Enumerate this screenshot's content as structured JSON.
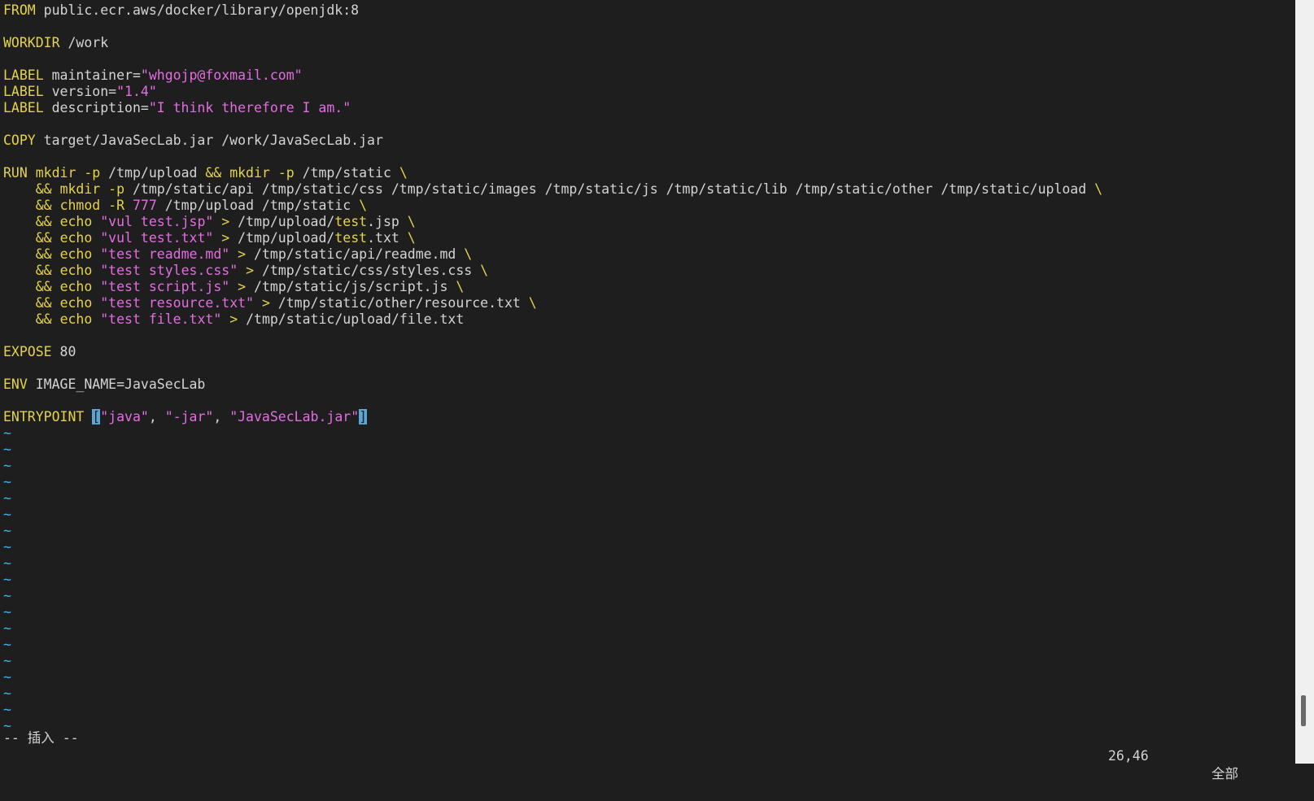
{
  "editor": {
    "lines": [
      [
        {
          "c": "kw",
          "t": "FROM"
        },
        {
          "c": "txt",
          "t": " public.ecr.aws/docker/library/openjdk:8"
        }
      ],
      [],
      [
        {
          "c": "kw",
          "t": "WORKDIR"
        },
        {
          "c": "txt",
          "t": " /work"
        }
      ],
      [],
      [
        {
          "c": "kw",
          "t": "LABEL"
        },
        {
          "c": "txt",
          "t": " maintainer="
        },
        {
          "c": "str",
          "t": "\"whgojp@foxmail.com\""
        }
      ],
      [
        {
          "c": "kw",
          "t": "LABEL"
        },
        {
          "c": "txt",
          "t": " version="
        },
        {
          "c": "str",
          "t": "\"1.4\""
        }
      ],
      [
        {
          "c": "kw",
          "t": "LABEL"
        },
        {
          "c": "txt",
          "t": " description="
        },
        {
          "c": "str",
          "t": "\"I think therefore I am.\""
        }
      ],
      [],
      [
        {
          "c": "kw",
          "t": "COPY"
        },
        {
          "c": "txt",
          "t": " target/JavaSecLab.jar /work/JavaSecLab.jar"
        }
      ],
      [],
      [
        {
          "c": "kw",
          "t": "RUN"
        },
        {
          "c": "txt",
          "t": " "
        },
        {
          "c": "cmd",
          "t": "mkdir"
        },
        {
          "c": "txt",
          "t": " "
        },
        {
          "c": "opt",
          "t": "-p"
        },
        {
          "c": "txt",
          "t": " /tmp/upload "
        },
        {
          "c": "amp",
          "t": "&&"
        },
        {
          "c": "txt",
          "t": " "
        },
        {
          "c": "cmd",
          "t": "mkdir"
        },
        {
          "c": "txt",
          "t": " "
        },
        {
          "c": "opt",
          "t": "-p"
        },
        {
          "c": "txt",
          "t": " /tmp/static "
        },
        {
          "c": "bs",
          "t": "\\"
        }
      ],
      [
        {
          "c": "txt",
          "t": "    "
        },
        {
          "c": "amp",
          "t": "&&"
        },
        {
          "c": "txt",
          "t": " "
        },
        {
          "c": "cmd",
          "t": "mkdir"
        },
        {
          "c": "txt",
          "t": " "
        },
        {
          "c": "opt",
          "t": "-p"
        },
        {
          "c": "txt",
          "t": " /tmp/static/api /tmp/static/css /tmp/static/images /tmp/static/js /tmp/static/lib /tmp/static/other /tmp/static/upload "
        },
        {
          "c": "bs",
          "t": "\\"
        }
      ],
      [
        {
          "c": "txt",
          "t": "    "
        },
        {
          "c": "amp",
          "t": "&&"
        },
        {
          "c": "txt",
          "t": " "
        },
        {
          "c": "cmd",
          "t": "chmod"
        },
        {
          "c": "txt",
          "t": " "
        },
        {
          "c": "opt",
          "t": "-R"
        },
        {
          "c": "txt",
          "t": " "
        },
        {
          "c": "num",
          "t": "777"
        },
        {
          "c": "txt",
          "t": " /tmp/upload /tmp/static "
        },
        {
          "c": "bs",
          "t": "\\"
        }
      ],
      [
        {
          "c": "txt",
          "t": "    "
        },
        {
          "c": "amp",
          "t": "&&"
        },
        {
          "c": "txt",
          "t": " "
        },
        {
          "c": "cmd",
          "t": "echo"
        },
        {
          "c": "txt",
          "t": " "
        },
        {
          "c": "str",
          "t": "\"vul test.jsp\""
        },
        {
          "c": "txt",
          "t": " "
        },
        {
          "c": "amp",
          "t": ">"
        },
        {
          "c": "txt",
          "t": " /tmp/upload/"
        },
        {
          "c": "dir",
          "t": "test"
        },
        {
          "c": "txt",
          "t": ".jsp "
        },
        {
          "c": "bs",
          "t": "\\"
        }
      ],
      [
        {
          "c": "txt",
          "t": "    "
        },
        {
          "c": "amp",
          "t": "&&"
        },
        {
          "c": "txt",
          "t": " "
        },
        {
          "c": "cmd",
          "t": "echo"
        },
        {
          "c": "txt",
          "t": " "
        },
        {
          "c": "str",
          "t": "\"vul test.txt\""
        },
        {
          "c": "txt",
          "t": " "
        },
        {
          "c": "amp",
          "t": ">"
        },
        {
          "c": "txt",
          "t": " /tmp/upload/"
        },
        {
          "c": "dir",
          "t": "test"
        },
        {
          "c": "txt",
          "t": ".txt "
        },
        {
          "c": "bs",
          "t": "\\"
        }
      ],
      [
        {
          "c": "txt",
          "t": "    "
        },
        {
          "c": "amp",
          "t": "&&"
        },
        {
          "c": "txt",
          "t": " "
        },
        {
          "c": "cmd",
          "t": "echo"
        },
        {
          "c": "txt",
          "t": " "
        },
        {
          "c": "str",
          "t": "\"test readme.md\""
        },
        {
          "c": "txt",
          "t": " "
        },
        {
          "c": "amp",
          "t": ">"
        },
        {
          "c": "txt",
          "t": " /tmp/static/api/readme.md "
        },
        {
          "c": "bs",
          "t": "\\"
        }
      ],
      [
        {
          "c": "txt",
          "t": "    "
        },
        {
          "c": "amp",
          "t": "&&"
        },
        {
          "c": "txt",
          "t": " "
        },
        {
          "c": "cmd",
          "t": "echo"
        },
        {
          "c": "txt",
          "t": " "
        },
        {
          "c": "str",
          "t": "\"test styles.css\""
        },
        {
          "c": "txt",
          "t": " "
        },
        {
          "c": "amp",
          "t": ">"
        },
        {
          "c": "txt",
          "t": " /tmp/static/css/styles.css "
        },
        {
          "c": "bs",
          "t": "\\"
        }
      ],
      [
        {
          "c": "txt",
          "t": "    "
        },
        {
          "c": "amp",
          "t": "&&"
        },
        {
          "c": "txt",
          "t": " "
        },
        {
          "c": "cmd",
          "t": "echo"
        },
        {
          "c": "txt",
          "t": " "
        },
        {
          "c": "str",
          "t": "\"test script.js\""
        },
        {
          "c": "txt",
          "t": " "
        },
        {
          "c": "amp",
          "t": ">"
        },
        {
          "c": "txt",
          "t": " /tmp/static/js/script.js "
        },
        {
          "c": "bs",
          "t": "\\"
        }
      ],
      [
        {
          "c": "txt",
          "t": "    "
        },
        {
          "c": "amp",
          "t": "&&"
        },
        {
          "c": "txt",
          "t": " "
        },
        {
          "c": "cmd",
          "t": "echo"
        },
        {
          "c": "txt",
          "t": " "
        },
        {
          "c": "str",
          "t": "\"test resource.txt\""
        },
        {
          "c": "txt",
          "t": " "
        },
        {
          "c": "amp",
          "t": ">"
        },
        {
          "c": "txt",
          "t": " /tmp/static/other/resource.txt "
        },
        {
          "c": "bs",
          "t": "\\"
        }
      ],
      [
        {
          "c": "txt",
          "t": "    "
        },
        {
          "c": "amp",
          "t": "&&"
        },
        {
          "c": "txt",
          "t": " "
        },
        {
          "c": "cmd",
          "t": "echo"
        },
        {
          "c": "txt",
          "t": " "
        },
        {
          "c": "str",
          "t": "\"test file.txt\""
        },
        {
          "c": "txt",
          "t": " "
        },
        {
          "c": "amp",
          "t": ">"
        },
        {
          "c": "txt",
          "t": " /tmp/static/upload/file.txt"
        }
      ],
      [],
      [
        {
          "c": "kw",
          "t": "EXPOSE"
        },
        {
          "c": "txt",
          "t": " 80"
        }
      ],
      [],
      [
        {
          "c": "kw",
          "t": "ENV"
        },
        {
          "c": "txt",
          "t": " IMAGE_NAME=JavaSecLab"
        }
      ],
      [],
      [
        {
          "c": "kw",
          "t": "ENTRYPOINT"
        },
        {
          "c": "txt",
          "t": " "
        },
        {
          "c": "cur",
          "t": "["
        },
        {
          "c": "str",
          "t": "\"java\""
        },
        {
          "c": "txt",
          "t": ", "
        },
        {
          "c": "str",
          "t": "\"-jar\""
        },
        {
          "c": "txt",
          "t": ", "
        },
        {
          "c": "str",
          "t": "\"JavaSecLab.jar\""
        },
        {
          "c": "cur",
          "t": "]"
        }
      ]
    ],
    "tilde_char": "~",
    "tilde_count": 19
  },
  "status": {
    "mode": "-- 插入 --",
    "position": "26,46",
    "percent": "全部"
  },
  "scrollbar": {
    "position": 1.0
  },
  "colors": {
    "background": "#1e1e1e",
    "keyword": "#e5d34a",
    "string": "#e26ee0",
    "tilde": "#3fb4e8",
    "cursor": "#5aa6d4"
  }
}
